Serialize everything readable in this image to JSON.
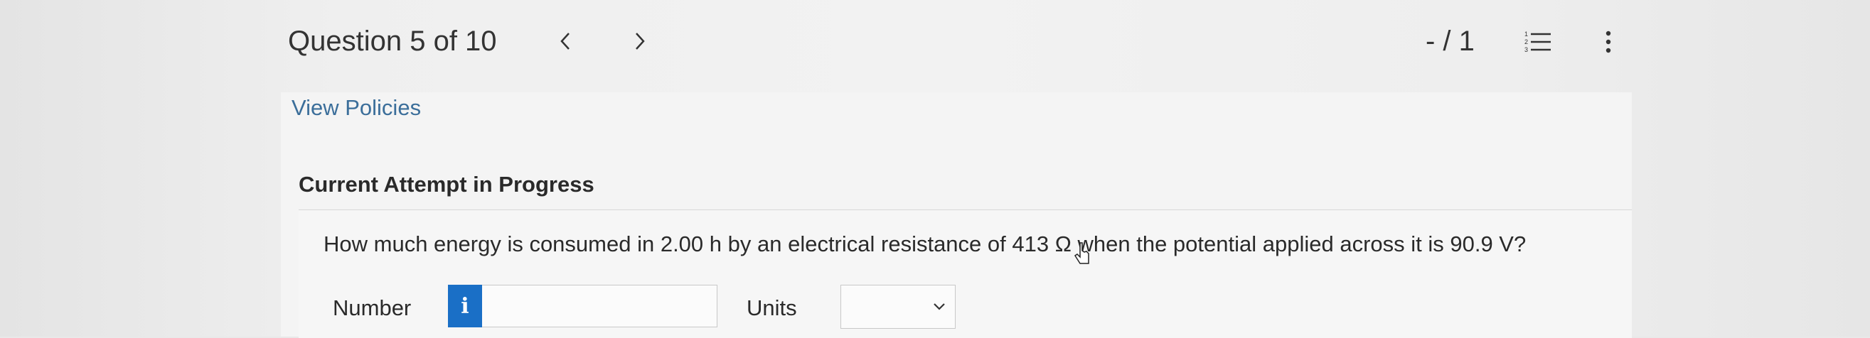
{
  "header": {
    "question_counter": "Question 5 of 10",
    "prev_label": "<",
    "next_label": ">",
    "score": "- / 1",
    "list_icon": "numbered-list-icon",
    "more_icon": "more-vertical-icon"
  },
  "main": {
    "view_policies": "View Policies",
    "attempt_heading": "Current Attempt in Progress",
    "question_text": "How much energy is consumed in 2.00 h by an electrical resistance of 413 Ω when the potential applied across it is 90.9 V?",
    "number_label": "Number",
    "number_value": "",
    "info_icon": "i",
    "units_label": "Units",
    "units_selected": ""
  },
  "colors": {
    "accent_blue": "#1a6fc6",
    "link_blue": "#3b6e9a",
    "text": "#2a2a2a",
    "background": "#efefef"
  }
}
